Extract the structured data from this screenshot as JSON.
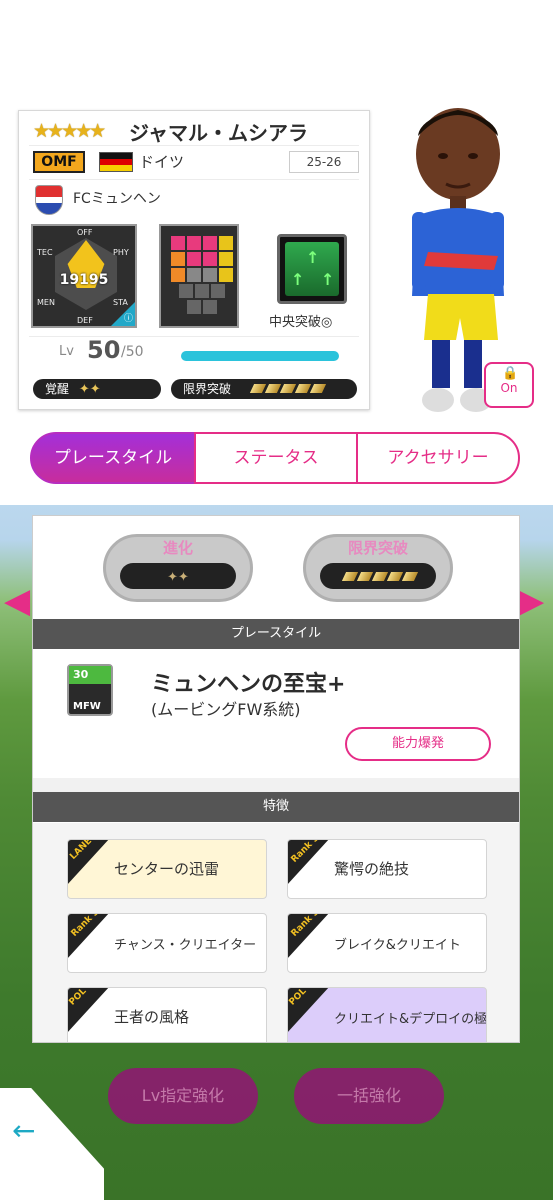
{
  "player": {
    "stars": "★★★★★",
    "name": "ジャマル・ムシアラ",
    "position": "OMF",
    "nation": "ドイツ",
    "season": "25-26",
    "club": "FCミュンヘン",
    "radar_labels": {
      "off": "OFF",
      "tec": "TEC",
      "phy": "PHY",
      "men": "MEN",
      "sta": "STA",
      "def": "DEF"
    },
    "total_power": "19195",
    "skill_label": "中央突破◎",
    "level_prefix": "Lv",
    "level": "50",
    "level_max": "/50",
    "level_progress": 1.0,
    "awakening_label": "覚醒",
    "limit_break_label": "限界突破"
  },
  "lock": {
    "label": "On"
  },
  "tabs": [
    {
      "label": "プレースタイル"
    },
    {
      "label": "ステータス"
    },
    {
      "label": "アクセサリー"
    }
  ],
  "panel": {
    "evolution_label": "進化",
    "limit_break_label": "限界突破",
    "playstyle_header": "プレースタイル",
    "playstyle_icon_level": "30",
    "playstyle_icon_code": "MFW",
    "playstyle_name": "ミュンヘンの至宝+",
    "playstyle_sub": "(ムービングFW系統)",
    "ability_button": "能力爆発",
    "features_header": "特徴",
    "features": [
      {
        "tag": "LANE",
        "label": "センターの迅雷",
        "color": "#fff6d6"
      },
      {
        "tag": "Rank S",
        "label": "驚愕の絶技",
        "color": "#ffffff"
      },
      {
        "tag": "Rank S",
        "label": "チャンス・クリエイター",
        "color": "#ffffff"
      },
      {
        "tag": "Rank S",
        "label": "ブレイク&クリエイト",
        "color": "#ffffff"
      },
      {
        "tag": "POL",
        "label": "王者の風格",
        "color": "#ffffff"
      },
      {
        "tag": "POL",
        "label": "クリエイト&デプロイの極意",
        "color": "#dccdfa"
      }
    ]
  },
  "bottom": {
    "lv_enhance": "Lv指定強化",
    "bulk_enhance": "一括強化"
  },
  "icons": {
    "back": "arrow-left-icon",
    "lock": "lock-icon"
  }
}
